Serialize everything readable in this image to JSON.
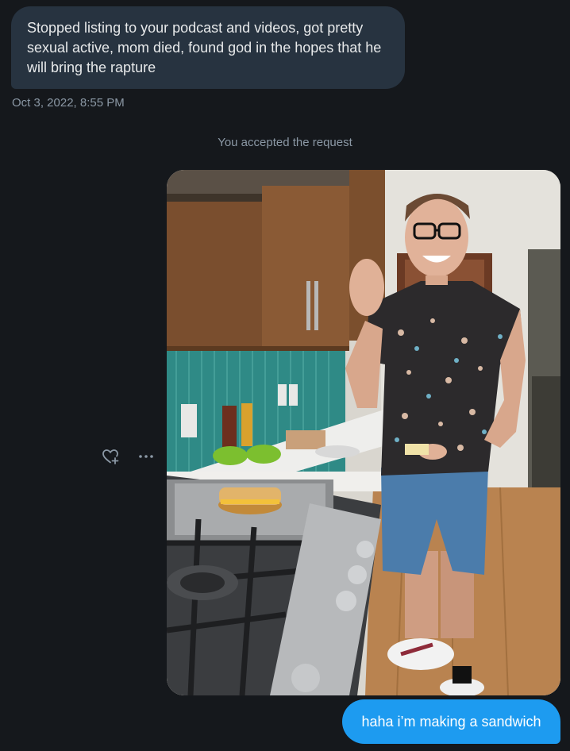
{
  "conversation": {
    "received_message": {
      "text": "Stopped listing to your podcast and videos, got pretty sexual active, mom died, found god in the hopes that he will bring the rapture",
      "timestamp": "Oct 3, 2022, 8:55 PM"
    },
    "system_note": "You accepted the request",
    "media_message": {
      "type": "photo"
    },
    "sent_message": {
      "text": "haha i’m making a sandwich"
    },
    "message_actions": {
      "react_icon": "heart-plus-icon",
      "more_icon": "more-horizontal-icon"
    }
  },
  "colors": {
    "background": "#15181c",
    "received_bubble": "#273340",
    "sent_bubble": "#1d9bf0",
    "secondary_text": "#8b98a5"
  }
}
